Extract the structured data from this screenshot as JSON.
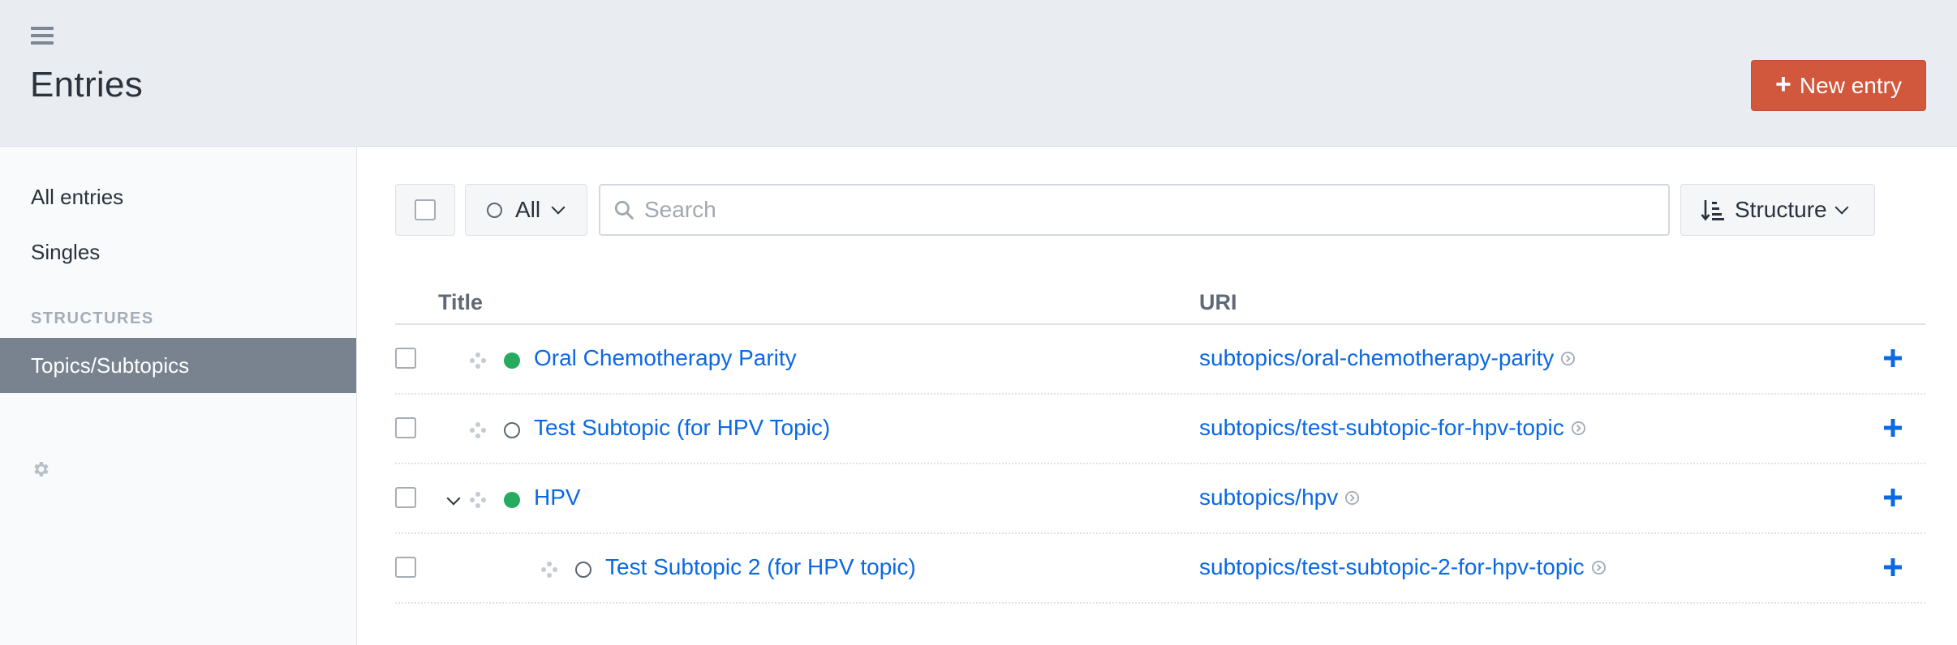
{
  "header": {
    "title": "Entries",
    "new_entry_label": "New entry",
    "new_entry_color": "#d1573d"
  },
  "sidebar": {
    "items": [
      {
        "label": "All entries"
      },
      {
        "label": "Singles"
      }
    ],
    "heading": "STRUCTURES",
    "structures": [
      {
        "label": "Topics/Subtopics",
        "active": true
      }
    ],
    "settings_icon": "gear-icon"
  },
  "toolbar": {
    "status_filter": "All",
    "search_placeholder": "Search",
    "sort_label": "Structure",
    "sort_icon": "sort-ascending-icon"
  },
  "table": {
    "columns": [
      "Title",
      "URI"
    ],
    "rows": [
      {
        "title": "Oral Chemotherapy Parity",
        "uri": "subtopics/oral-chemotherapy-parity",
        "status": "live",
        "level": 1,
        "expandable": false
      },
      {
        "title": "Test Subtopic (for HPV Topic)",
        "uri": "subtopics/test-subtopic-for-hpv-topic",
        "status": "disabled",
        "level": 1,
        "expandable": false
      },
      {
        "title": "HPV",
        "uri": "subtopics/hpv",
        "status": "live",
        "level": 1,
        "expandable": true
      },
      {
        "title": "Test Subtopic 2 (for HPV topic)",
        "uri": "subtopics/test-subtopic-2-for-hpv-topic",
        "status": "disabled",
        "level": 2,
        "expandable": false
      }
    ]
  },
  "colors": {
    "link": "#0b69e3",
    "live_status": "#27ab5f",
    "active_nav": "#78838f"
  }
}
